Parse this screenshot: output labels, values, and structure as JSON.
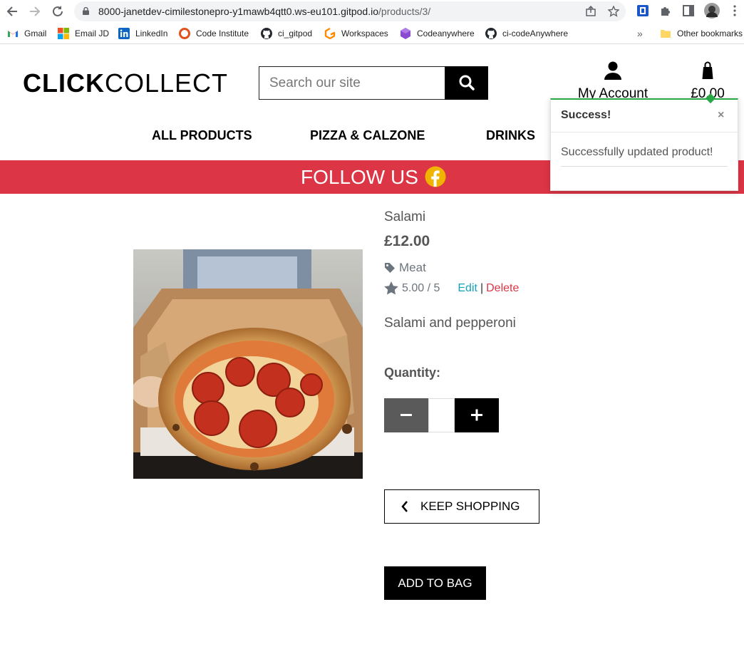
{
  "browser": {
    "url_host": "8000-janetdev-cimilestonepro-y1mawb4qtt0.ws-eu101.gitpod.io",
    "url_path": "/products/3/",
    "bookmarks": [
      {
        "label": "Gmail",
        "icon": "gmail-icon"
      },
      {
        "label": "Email JD",
        "icon": "microsoft-icon"
      },
      {
        "label": "LinkedIn",
        "icon": "linkedin-icon"
      },
      {
        "label": "Code Institute",
        "icon": "code-institute-icon"
      },
      {
        "label": "ci_gitpod",
        "icon": "github-icon"
      },
      {
        "label": "Workspaces",
        "icon": "gitpod-icon"
      },
      {
        "label": "Codeanywhere",
        "icon": "codeanywhere-icon"
      },
      {
        "label": "ci-codeAnywhere",
        "icon": "github-icon"
      }
    ],
    "overflow": "»",
    "other_bookmarks": "Other bookmarks"
  },
  "site": {
    "logo_bold": "CLICK",
    "logo_light": "COLLECT",
    "search_placeholder": "Search our site",
    "account_label": "My Account",
    "bag_total": "£0.00",
    "nav": [
      "ALL PRODUCTS",
      "PIZZA & CALZONE",
      "DRINKS"
    ],
    "banner": "FOLLOW US",
    "accent": "#dc3545"
  },
  "toast": {
    "title": "Success!",
    "close": "×",
    "message": "Successfully updated product!",
    "color": "#28a745"
  },
  "product": {
    "name": "Salami",
    "price": "£12.00",
    "category": "Meat",
    "rating": "5.00 / 5",
    "edit": "Edit",
    "separator": "|",
    "delete": "Delete",
    "description": "Salami and pepperoni",
    "quantity_label": "Quantity:",
    "quantity_value": "",
    "keep_shopping": "KEEP SHOPPING",
    "add_to_bag": "ADD TO BAG"
  }
}
